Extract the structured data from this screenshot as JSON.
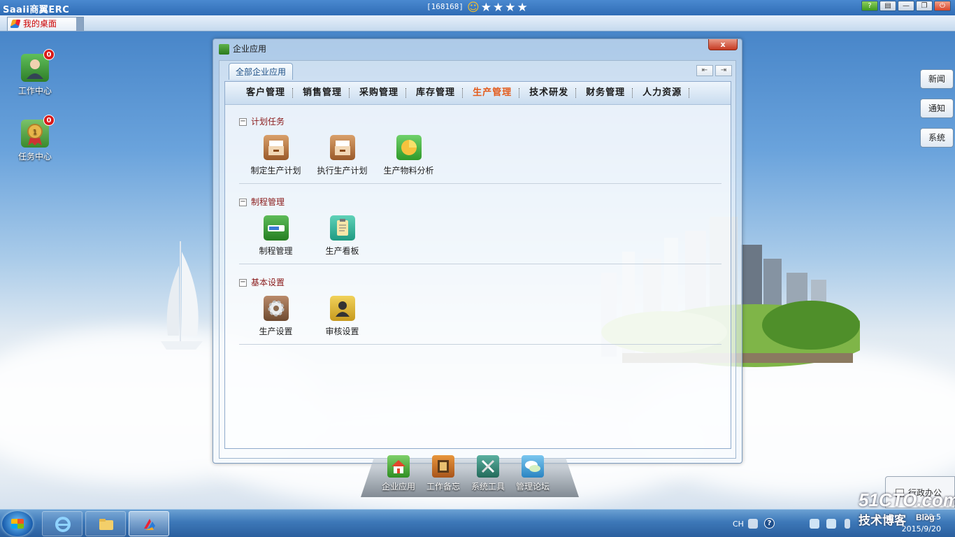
{
  "top_bar": {
    "app_title": "Saaii商翼ERC",
    "user_id": "[168168]",
    "rating_icons": [
      "smiley-icon",
      "star-icon",
      "star-icon",
      "star-icon",
      "star-icon"
    ],
    "window_buttons": [
      "help-icon",
      "manual-icon",
      "minimize-icon",
      "restore-icon",
      "power-icon"
    ]
  },
  "tab_bar": {
    "desktop_tab": "我的桌面"
  },
  "desktop_icons": [
    {
      "label": "工作中心",
      "badge": "0",
      "icon": "user-icon"
    },
    {
      "label": "任务中心",
      "badge": "0",
      "icon": "medal-icon"
    }
  ],
  "side_buttons": [
    "新闻",
    "通知",
    "系统"
  ],
  "window": {
    "title": "企业应用",
    "close_label": "x",
    "top_tab": "全部企业应用",
    "categories": [
      "客户管理",
      "销售管理",
      "采购管理",
      "库存管理",
      "生产管理",
      "技术研发",
      "财务管理",
      "人力资源"
    ],
    "active_category": "生产管理",
    "sections": [
      {
        "title": "计划任务",
        "apps": [
          {
            "label": "制定生产计划",
            "icon": "archive-box-icon"
          },
          {
            "label": "执行生产计划",
            "icon": "archive-box-icon"
          },
          {
            "label": "生产物料分析",
            "icon": "pie-chart-icon"
          }
        ]
      },
      {
        "title": "制程管理",
        "apps": [
          {
            "label": "制程管理",
            "icon": "progress-bar-icon"
          },
          {
            "label": "生产看板",
            "icon": "clipboard-icon"
          }
        ]
      },
      {
        "title": "基本设置",
        "apps": [
          {
            "label": "生产设置",
            "icon": "gear-icon"
          },
          {
            "label": "审核设置",
            "icon": "person-icon"
          }
        ]
      }
    ]
  },
  "dock": [
    {
      "label": "企业应用",
      "icon": "home-icon"
    },
    {
      "label": "工作备忘",
      "icon": "memo-icon"
    },
    {
      "label": "系统工具",
      "icon": "tools-icon"
    },
    {
      "label": "管理论坛",
      "icon": "chat-icon"
    }
  ],
  "popup": {
    "label": "行政办公"
  },
  "taskbar": {
    "language": "CH",
    "time": "20:5",
    "date": "2015/9/20"
  },
  "watermark": {
    "site": "51CTO.com",
    "blog_cn": "技术博客",
    "blog_en": "Blog"
  },
  "colors": {
    "accent": "#e35b1c",
    "section_title": "#8a1a1a",
    "badge": "#d81a1a"
  }
}
